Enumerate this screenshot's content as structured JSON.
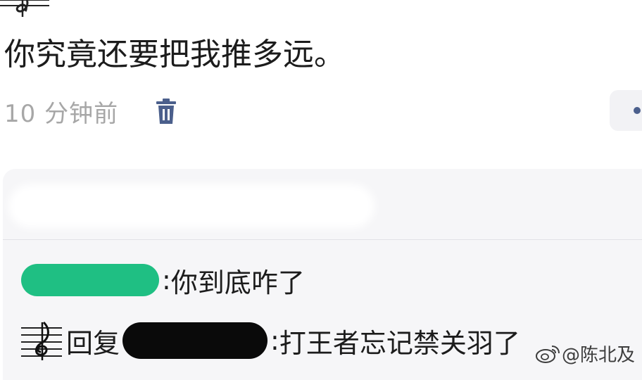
{
  "post": {
    "text": "你究竟还要把我推多远。",
    "timestamp": "10 分钟前"
  },
  "icons": {
    "delete": "trash-icon",
    "more": "more-dots-icon",
    "avatar": "treble-clef-icon",
    "watermark": "weibo-icon"
  },
  "replies": [
    {
      "separator": ":",
      "text": "你到底咋了"
    },
    {
      "prefix": "回复",
      "separator": ":",
      "text": "打王者忘记禁关羽了"
    }
  ],
  "watermark": {
    "text": "@陈北及"
  },
  "colors": {
    "timestamp": "#a7a7a7",
    "accent": "#4b5f8c",
    "redact_green": "#1fbf83",
    "redact_black": "#0a0a0a",
    "panel_bg": "#f6f6f8"
  }
}
